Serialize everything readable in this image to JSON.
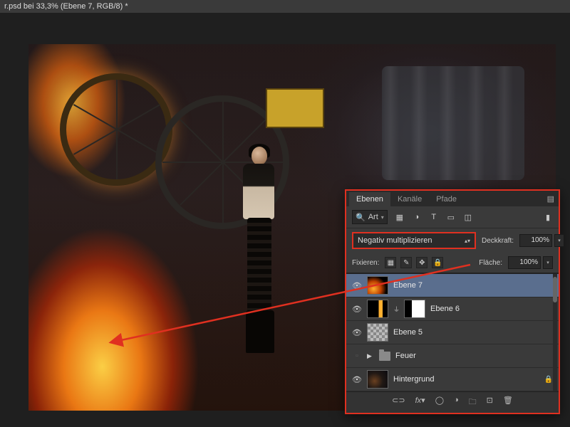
{
  "titlebar": "r.psd bei 33,3% (Ebene 7, RGB/8) *",
  "panel": {
    "tabs": [
      "Ebenen",
      "Kanäle",
      "Pfade"
    ],
    "active_tab": 0,
    "kind_label": "Art",
    "blend_mode": "Negativ multiplizieren",
    "opacity_label": "Deckkraft:",
    "opacity_value": "100%",
    "lock_label": "Fixieren:",
    "fill_label": "Fläche:",
    "fill_value": "100%",
    "layers": [
      {
        "name": "Ebene 7",
        "visible": true,
        "selected": true,
        "thumb": "fire"
      },
      {
        "name": "Ebene 6",
        "visible": true,
        "thumb": "mask",
        "linked": true,
        "mask": true
      },
      {
        "name": "Ebene 5",
        "visible": true,
        "thumb": "chk"
      },
      {
        "name": "Feuer",
        "visible": false,
        "group": true
      },
      {
        "name": "Hintergrund",
        "visible": true,
        "thumb": "bg",
        "locked": true
      }
    ]
  }
}
